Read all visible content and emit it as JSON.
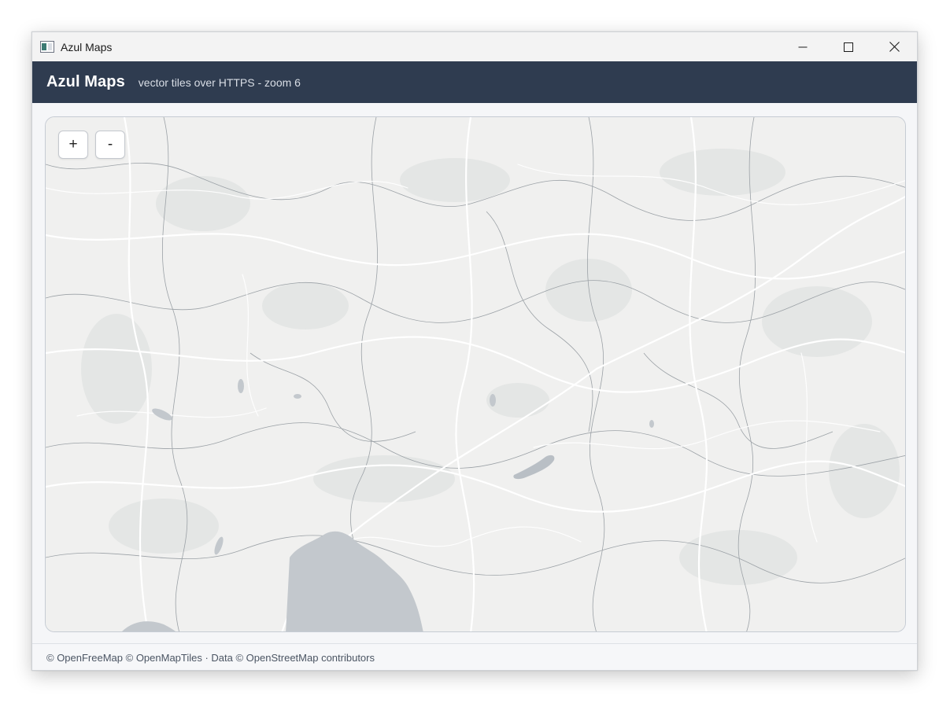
{
  "window": {
    "title": "Azul Maps",
    "controls": {
      "minimize": "minimize-icon",
      "maximize": "maximize-icon",
      "close": "close-icon"
    }
  },
  "header": {
    "brand": "Azul Maps",
    "subtitle": "vector tiles over HTTPS - zoom 6"
  },
  "map": {
    "zoom_in_label": "+",
    "zoom_out_label": "-",
    "colors": {
      "land": "#f0f0ef",
      "forest": "#e3e5e4",
      "water": "#c3c8cd",
      "roads": "#ffffff",
      "borders": "#8e9499"
    }
  },
  "footer": {
    "attribution": "© OpenFreeMap © OpenMapTiles · Data © OpenStreetMap contributors"
  },
  "colors": {
    "header_bg": "#2f3c50",
    "titlebar_bg": "#f3f3f3"
  }
}
